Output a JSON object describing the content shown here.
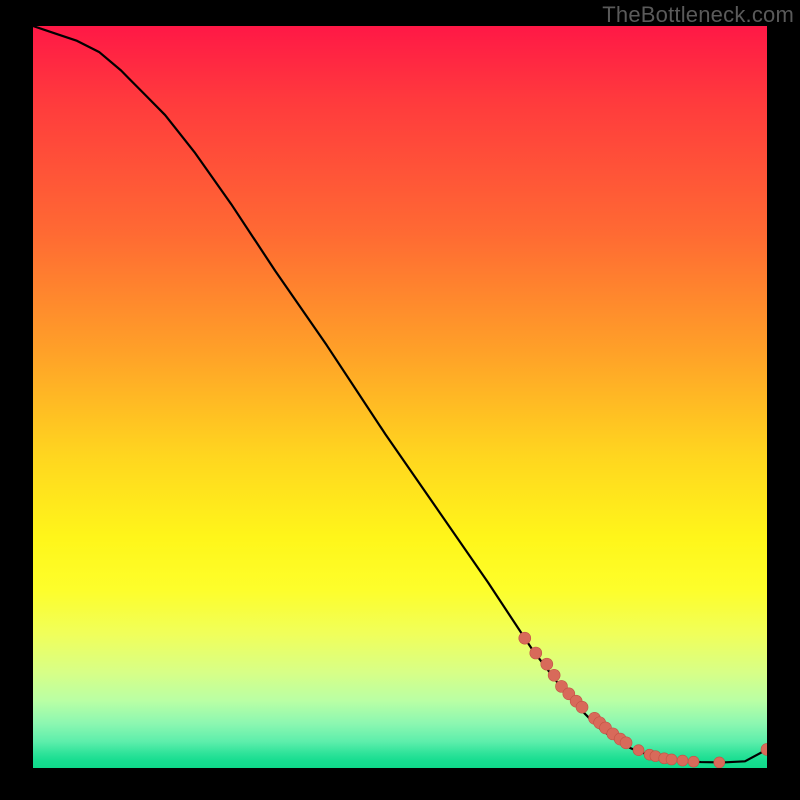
{
  "watermark": "TheBottleneck.com",
  "colors": {
    "page_bg": "#000000",
    "curve_stroke": "#000000",
    "point_fill": "#d86a5a",
    "point_stroke": "#c25245",
    "watermark_text": "#5a5a5a"
  },
  "chart_data": {
    "type": "line",
    "title": "",
    "xlabel": "",
    "ylabel": "",
    "xlim": [
      0,
      100
    ],
    "ylim": [
      0,
      100
    ],
    "grid": false,
    "legend": false,
    "curve": {
      "x": [
        0,
        3,
        6,
        9,
        12,
        15,
        18,
        22,
        27,
        33,
        40,
        48,
        55,
        62,
        68,
        73,
        77,
        80,
        82.5,
        85,
        87,
        89,
        91,
        94,
        97,
        100
      ],
      "y": [
        100,
        99,
        98,
        96.5,
        94,
        91,
        88,
        83,
        76,
        67,
        57,
        45,
        35,
        25,
        16,
        9.5,
        5.5,
        3.3,
        2.2,
        1.5,
        1.1,
        0.9,
        0.8,
        0.75,
        0.9,
        2.5
      ]
    },
    "series": [
      {
        "name": "points",
        "kind": "scatter",
        "x": [
          67,
          68.5,
          70,
          71,
          72,
          73,
          74,
          74.8,
          76.5,
          77.2,
          78,
          79,
          80,
          80.8,
          82.5,
          84,
          84.8,
          86,
          87,
          88.5,
          90,
          93.5,
          100
        ],
        "y": [
          17.5,
          15.5,
          14,
          12.5,
          11,
          10,
          9,
          8.2,
          6.7,
          6.1,
          5.4,
          4.6,
          3.9,
          3.4,
          2.4,
          1.8,
          1.6,
          1.3,
          1.15,
          1.0,
          0.85,
          0.75,
          2.5
        ],
        "r": [
          6,
          6,
          6,
          6,
          6,
          6,
          6,
          6,
          6,
          6,
          6,
          6,
          6,
          6,
          5.5,
          5.5,
          5.5,
          5.5,
          5.5,
          5.5,
          5.5,
          5.5,
          6
        ]
      }
    ]
  }
}
